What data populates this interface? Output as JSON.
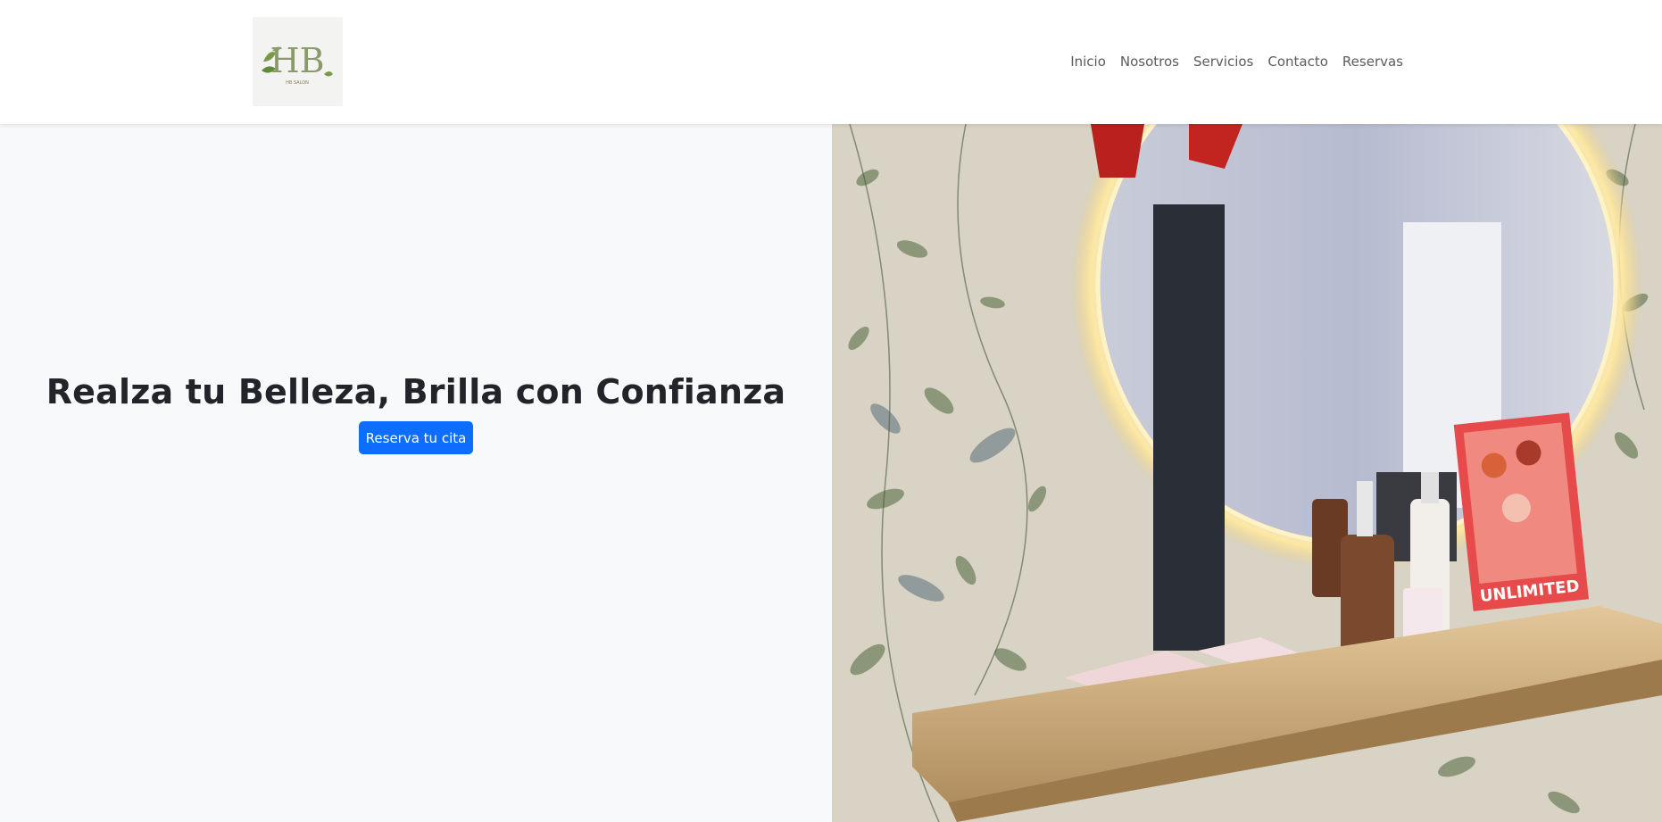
{
  "brand": {
    "logo_letters": "HB",
    "logo_sub": "HB SALON"
  },
  "nav": {
    "items": [
      {
        "label": "Inicio"
      },
      {
        "label": "Nosotros"
      },
      {
        "label": "Servicios"
      },
      {
        "label": "Contacto"
      },
      {
        "label": "Reservas"
      }
    ]
  },
  "hero": {
    "title": "Realza tu Belleza, Brilla con Confianza",
    "cta_label": "Reserva tu cita",
    "image_book_text": "UNLIMITED",
    "colors": {
      "cta": "#0d6efd",
      "background": "#f8f9fa",
      "title": "#212529"
    }
  }
}
